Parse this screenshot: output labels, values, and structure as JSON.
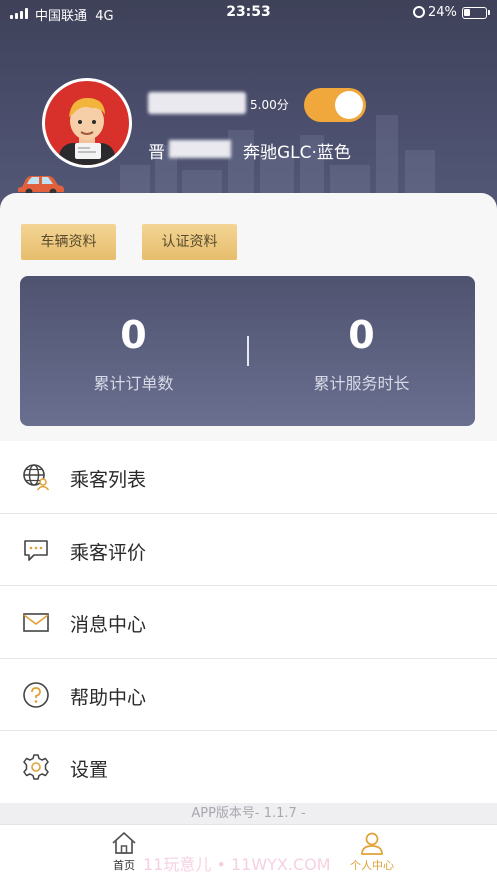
{
  "status_bar": {
    "carrier": "中国联通",
    "network": "4G",
    "time": "23:53",
    "battery": "24%"
  },
  "profile": {
    "rating": "5.00分",
    "plate_prefix": "晋",
    "car_model": "奔驰GLC·蓝色",
    "online_toggle": true
  },
  "buttons": {
    "vehicle_info": "车辆资料",
    "cert_info": "认证资料"
  },
  "stats": [
    {
      "value": "0",
      "label": "累计订单数"
    },
    {
      "value": "0",
      "label": "累计服务时长"
    }
  ],
  "menu": [
    {
      "label": "乘客列表",
      "icon": "globe-user-icon"
    },
    {
      "label": "乘客评价",
      "icon": "chat-bubble-icon"
    },
    {
      "label": "消息中心",
      "icon": "envelope-icon"
    },
    {
      "label": "帮助中心",
      "icon": "question-icon"
    },
    {
      "label": "设置",
      "icon": "gear-icon"
    }
  ],
  "version": "APP版本号- 1.1.7 -",
  "tabs": [
    {
      "label": "首页",
      "icon": "home-icon",
      "active": false
    },
    {
      "label": "个人中心",
      "icon": "person-icon",
      "active": true
    }
  ],
  "watermark": "11玩意儿 • 11WYX.COM",
  "colors": {
    "accent": "#f0a73b",
    "header_dark": "#3e4158",
    "active_tab": "#e0a238"
  }
}
